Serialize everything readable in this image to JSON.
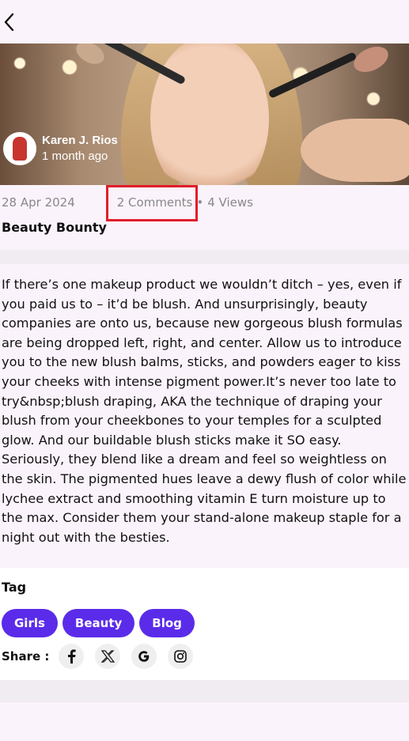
{
  "header": {
    "back_icon": "chevron-left-icon"
  },
  "hero": {
    "author_name": "Karen J. Rios",
    "author_time": "1 month ago"
  },
  "meta": {
    "date": "28 Apr 2024",
    "comments": "2 Comments",
    "separator": "•",
    "views": "4 Views"
  },
  "post": {
    "title": "Beauty Bounty",
    "body": "If there’s one makeup product we wouldn’t ditch – yes, even if you paid us to – it’d be blush. And unsurprisingly, beauty companies are onto us, because new gorgeous blush formulas are being dropped left, right, and center. Allow us to introduce you to the new blush balms, sticks, and powders eager to kiss your cheeks with intense pigment power.It’s never too late to try&nbsp;blush draping, AKA the technique of draping your blush from your cheekbones to your temples for a sculpted glow. And our buildable blush sticks make it SO easy. Seriously, they blend like a dream and feel so weightless on the skin. The pigmented hues leave a dewy flush of color while lychee extract and smoothing vitamin E turn moisture up to the max. Consider them your stand-alone makeup staple for a night out with the besties."
  },
  "tags": {
    "heading": "Tag",
    "items": [
      "Girls",
      "Beauty",
      "Blog"
    ]
  },
  "share": {
    "label": "Share :",
    "icons": [
      "facebook-icon",
      "x-twitter-icon",
      "google-icon",
      "instagram-icon"
    ]
  },
  "colors": {
    "accent": "#5b2bea",
    "highlight": "#e11d2b",
    "background": "#fbf3fb"
  }
}
